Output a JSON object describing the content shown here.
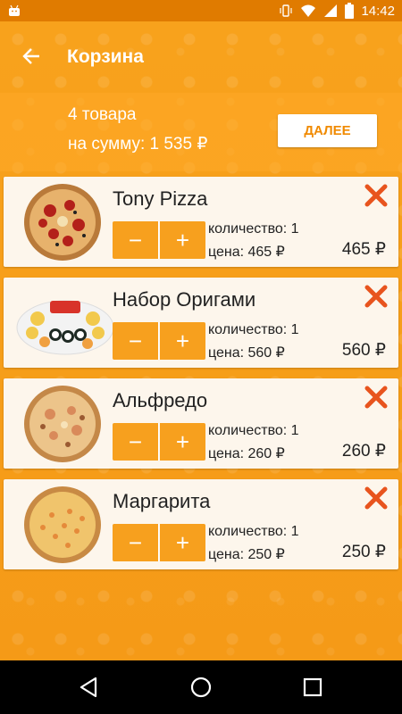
{
  "status_bar": {
    "time": "14:42"
  },
  "header": {
    "title": "Корзина"
  },
  "summary": {
    "items_count": "4 товара",
    "total": "на сумму: 1 535 ₽",
    "next_label": "ДАЛЕЕ"
  },
  "items": [
    {
      "name": "Tony Pizza",
      "qty_text": "количество: 1",
      "price_text": "цена: 465 ₽",
      "total_text": "465 ₽",
      "minus": "−",
      "plus": "+",
      "image": "pizza-icon"
    },
    {
      "name": "Набор Оригами",
      "qty_text": "количество: 1",
      "price_text": "цена: 560 ₽",
      "total_text": "560 ₽",
      "minus": "−",
      "plus": "+",
      "image": "sushi-set-icon"
    },
    {
      "name": "Альфредо",
      "qty_text": "количество: 1",
      "price_text": "цена: 260 ₽",
      "total_text": "260 ₽",
      "minus": "−",
      "plus": "+",
      "image": "pizza-icon"
    },
    {
      "name": "Маргарита",
      "qty_text": "количество: 1",
      "price_text": "цена: 250 ₽",
      "total_text": "250 ₽",
      "minus": "−",
      "plus": "+",
      "image": "pizza-icon"
    }
  ],
  "colors": {
    "accent": "#f7a01e",
    "status_bar": "#e07b00",
    "remove": "#e8541e",
    "card": "#fdf6ec"
  }
}
